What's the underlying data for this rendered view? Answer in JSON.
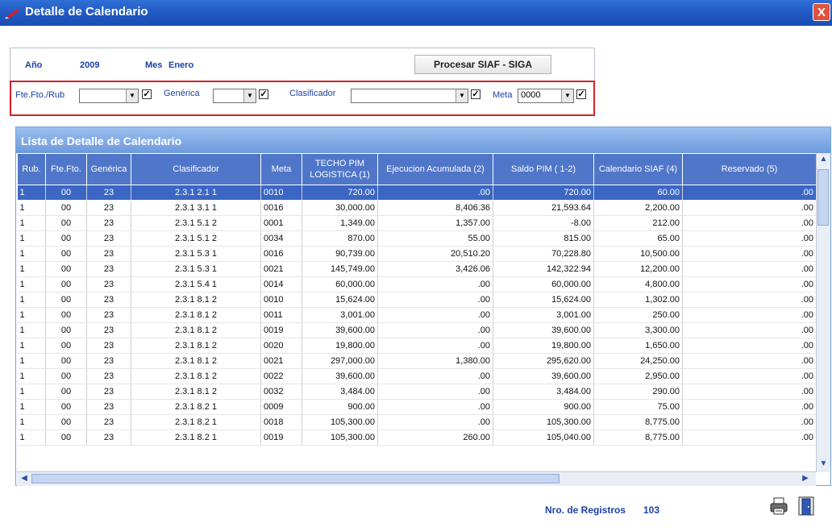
{
  "window": {
    "title": "Detalle de Calendario",
    "close_glyph": "X"
  },
  "header": {
    "anio_label": "Año",
    "anio_value": "2009",
    "mes_label": "Mes",
    "mes_value": "Enero",
    "procesar_label": "Procesar SIAF - SIGA"
  },
  "filters": {
    "fte_label": "Fte.Fto./Rub",
    "fte_value": "",
    "generica_label": "Genérica",
    "generica_value": "",
    "clasificador_label": "Clasificador",
    "clasificador_value": "",
    "meta_label": "Meta",
    "meta_value": "0000",
    "checkbox_glyph": "✓"
  },
  "grid": {
    "title": "Lista de Detalle de Calendario",
    "columns": [
      "Rub.",
      "Fte.Fto.",
      "Genérica",
      "Clasificador",
      "Meta",
      "TECHO PIM LOGISTICA (1)",
      "Ejecucion Acumulada (2)",
      "Saldo PIM ( 1-2)",
      "Calendario SIAF (4)",
      "Reservado (5)"
    ],
    "rows": [
      [
        "1",
        "00",
        "23",
        "2.3.1 2.1 1",
        "0010",
        "720.00",
        ".00",
        "720.00",
        "60.00",
        ".00"
      ],
      [
        "1",
        "00",
        "23",
        "2.3.1 3.1 1",
        "0016",
        "30,000.00",
        "8,406.36",
        "21,593.64",
        "2,200.00",
        ".00"
      ],
      [
        "1",
        "00",
        "23",
        "2.3.1 5.1 2",
        "0001",
        "1,349.00",
        "1,357.00",
        "-8.00",
        "212.00",
        ".00"
      ],
      [
        "1",
        "00",
        "23",
        "2.3.1 5.1 2",
        "0034",
        "870.00",
        "55.00",
        "815.00",
        "65.00",
        ".00"
      ],
      [
        "1",
        "00",
        "23",
        "2.3.1 5.3 1",
        "0016",
        "90,739.00",
        "20,510.20",
        "70,228.80",
        "10,500.00",
        ".00"
      ],
      [
        "1",
        "00",
        "23",
        "2.3.1 5.3 1",
        "0021",
        "145,749.00",
        "3,426.06",
        "142,322.94",
        "12,200.00",
        ".00"
      ],
      [
        "1",
        "00",
        "23",
        "2.3.1 5.4 1",
        "0014",
        "60,000.00",
        ".00",
        "60,000.00",
        "4,800.00",
        ".00"
      ],
      [
        "1",
        "00",
        "23",
        "2.3.1 8.1 2",
        "0010",
        "15,624.00",
        ".00",
        "15,624.00",
        "1,302.00",
        ".00"
      ],
      [
        "1",
        "00",
        "23",
        "2.3.1 8.1 2",
        "0011",
        "3,001.00",
        ".00",
        "3,001.00",
        "250.00",
        ".00"
      ],
      [
        "1",
        "00",
        "23",
        "2.3.1 8.1 2",
        "0019",
        "39,600.00",
        ".00",
        "39,600.00",
        "3,300.00",
        ".00"
      ],
      [
        "1",
        "00",
        "23",
        "2.3.1 8.1 2",
        "0020",
        "19,800.00",
        ".00",
        "19,800.00",
        "1,650.00",
        ".00"
      ],
      [
        "1",
        "00",
        "23",
        "2.3.1 8.1 2",
        "0021",
        "297,000.00",
        "1,380.00",
        "295,620.00",
        "24,250.00",
        ".00"
      ],
      [
        "1",
        "00",
        "23",
        "2.3.1 8.1 2",
        "0022",
        "39,600.00",
        ".00",
        "39,600.00",
        "2,950.00",
        ".00"
      ],
      [
        "1",
        "00",
        "23",
        "2.3.1 8.1 2",
        "0032",
        "3,484.00",
        ".00",
        "3,484.00",
        "290.00",
        ".00"
      ],
      [
        "1",
        "00",
        "23",
        "2.3.1 8.2 1",
        "0009",
        "900.00",
        ".00",
        "900.00",
        "75.00",
        ".00"
      ],
      [
        "1",
        "00",
        "23",
        "2.3.1 8.2 1",
        "0018",
        "105,300.00",
        ".00",
        "105,300.00",
        "8,775.00",
        ".00"
      ],
      [
        "1",
        "00",
        "23",
        "2.3.1 8.2 1",
        "0019",
        "105,300.00",
        "260.00",
        "105,040.00",
        "8,775.00",
        ".00"
      ]
    ]
  },
  "footer": {
    "registros_label": "Nro. de Registros",
    "registros_value": "103"
  },
  "icons": {
    "print": "printer-icon",
    "exit": "exit-door-icon"
  },
  "colors": {
    "title_bar": "#1f56c0",
    "selected_row": "#3b66c4",
    "header_bg": "#4f76c8",
    "highlight_box": "#d6202a"
  }
}
